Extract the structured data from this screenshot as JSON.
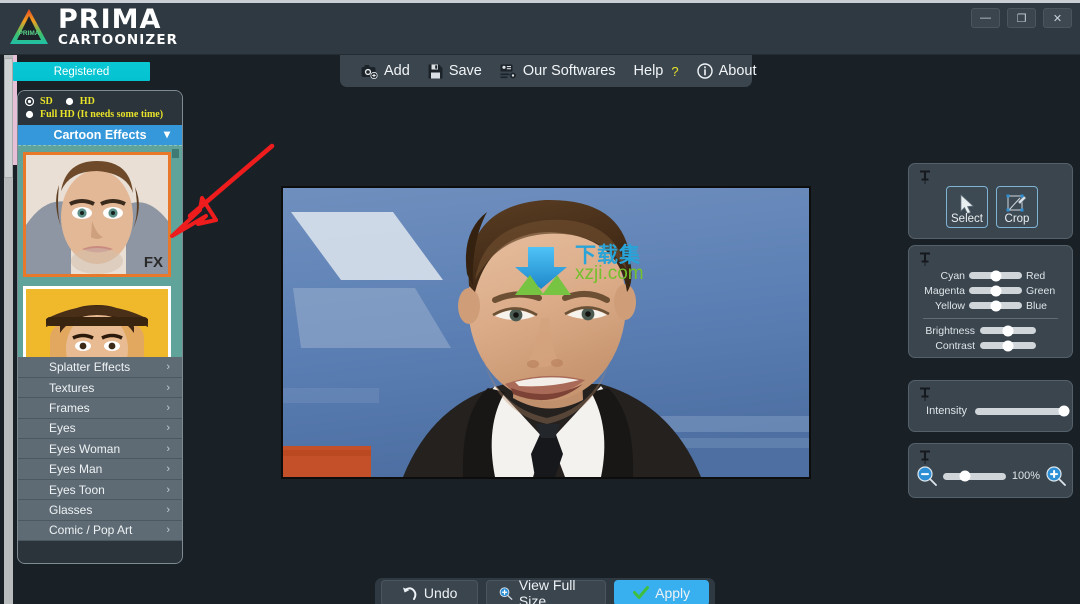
{
  "app": {
    "brand_line1": "PRIMA",
    "brand_line2": "CARTOONIZER",
    "logo_inner_text": "PRIMA",
    "accent_blue": "#3498db",
    "accent_cyan": "#05c2d0",
    "accent_orange": "#e8792a",
    "accent_yellow": "#e8e329",
    "panel_bg": "#3a454e",
    "window_bg": "#1a2126"
  },
  "window_controls": {
    "minimize": "minimize-icon",
    "restore": "restore-icon",
    "close": "close-icon"
  },
  "license": {
    "badge": "Registered"
  },
  "resolution": {
    "options": [
      {
        "label": "SD",
        "selected": true
      },
      {
        "label": "HD",
        "selected": false
      },
      {
        "label": "Full HD (It needs some time)",
        "selected": false
      }
    ]
  },
  "effects": {
    "header": "Cartoon Effects",
    "header_chevron": "chevron-down-icon",
    "thumbnails": [
      {
        "badge": "FX",
        "selected": true
      },
      {
        "badge": "",
        "selected": false
      }
    ],
    "categories": [
      "Splatter Effects",
      "Textures",
      "Frames",
      "Eyes",
      "Eyes Woman",
      "Eyes Man",
      "Eyes Toon",
      "Glasses",
      "Comic / Pop Art"
    ],
    "category_arrow": "chevron-right-icon"
  },
  "toolbar": {
    "items": [
      {
        "label": "Add",
        "icon": "camera-add-icon"
      },
      {
        "label": "Save",
        "icon": "floppy-disk-icon"
      },
      {
        "label": "Our Softwares",
        "icon": "software-list-icon"
      },
      {
        "label": "Help",
        "icon": "question-mark-icon",
        "suffix": "?"
      },
      {
        "label": "About",
        "icon": "info-circle-icon"
      }
    ]
  },
  "canvas": {
    "watermark_cn": "下载集",
    "watermark_en": "xzji.com",
    "watermark_icon": "download-arrow-icon",
    "annotation": "red-arrow-annotation"
  },
  "tools_panel": {
    "pin_icon": "pushpin-icon",
    "buttons": [
      {
        "label": "Select",
        "icon": "cursor-arrow-icon"
      },
      {
        "label": "Crop",
        "icon": "crop-icon"
      }
    ]
  },
  "color_panel": {
    "pin_icon": "pushpin-icon",
    "sliders": [
      {
        "left": "Cyan",
        "right": "Red",
        "value": 50
      },
      {
        "left": "Magenta",
        "right": "Green",
        "value": 50
      },
      {
        "left": "Yellow",
        "right": "Blue",
        "value": 50
      }
    ],
    "adjust": [
      {
        "label": "Brightness",
        "value": 50
      },
      {
        "label": "Contrast",
        "value": 50
      }
    ]
  },
  "intensity_panel": {
    "pin_icon": "pushpin-icon",
    "label": "Intensity",
    "value": 100
  },
  "zoom_panel": {
    "pin_icon": "pushpin-icon",
    "zoom_out_icon": "magnifier-minus-icon",
    "zoom_in_icon": "magnifier-plus-icon",
    "percent": "100%",
    "value": 35
  },
  "bottom_bar": {
    "undo": {
      "label": "Undo",
      "icon": "undo-arrow-icon"
    },
    "view_full_size": {
      "label": "View Full Size",
      "icon": "magnifier-plus-icon"
    },
    "apply": {
      "label": "Apply",
      "icon": "check-icon"
    }
  }
}
